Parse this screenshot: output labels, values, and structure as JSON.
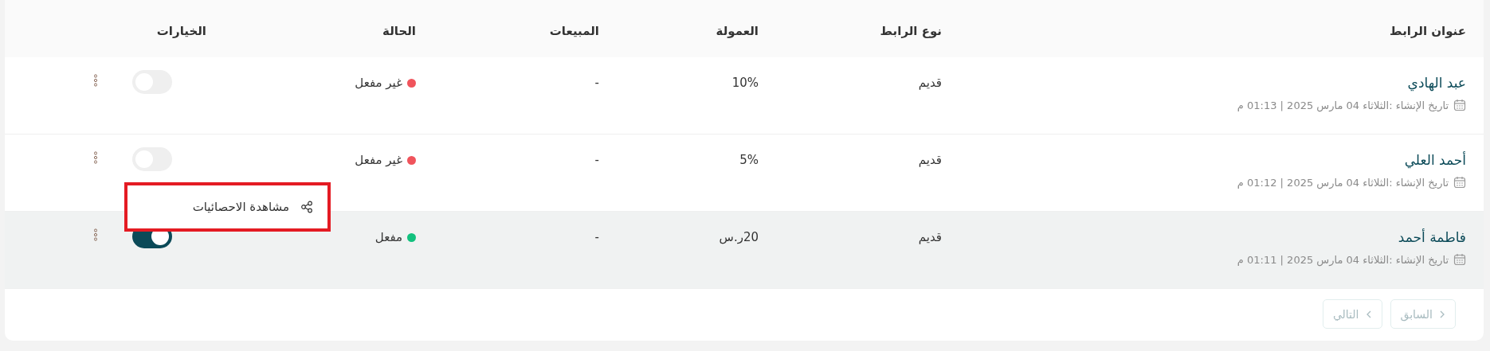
{
  "table": {
    "columns": [
      "عنوان الرابط",
      "نوع الرابط",
      "العمولة",
      "المبيعات",
      "الحالة",
      "الخيارات"
    ],
    "rows": [
      {
        "title": "عبد الهادي",
        "created": "تاريخ الإنشاء :الثلاثاء 04 مارس 2025 | 01:13 م",
        "type": "قديم",
        "commission": "10%",
        "sales": "-",
        "status": "غير مفعل",
        "color": "#f0545c",
        "on": false,
        "selected": false
      },
      {
        "title": "أحمد العلي",
        "created": "تاريخ الإنشاء :الثلاثاء 04 مارس 2025 | 01:12 م",
        "type": "قديم",
        "commission": "5%",
        "sales": "-",
        "status": "غير مفعل",
        "color": "#f0545c",
        "on": false,
        "selected": false
      },
      {
        "title": "فاطمة أحمد",
        "created": "تاريخ الإنشاء :الثلاثاء 04 مارس 2025 | 01:11 م",
        "type": "قديم",
        "commission": "20ر.س",
        "sales": "-",
        "status": "مفعل",
        "color": "#12c17e",
        "on": true,
        "selected": true
      }
    ]
  },
  "menu": {
    "items": [
      {
        "label": "مشاهدة الاحصائيات"
      }
    ]
  },
  "pagination": [
    {
      "label": "السابق",
      "kind": "prev",
      "disabled": true
    },
    {
      "label": "التالي",
      "kind": "next",
      "disabled": true
    }
  ]
}
